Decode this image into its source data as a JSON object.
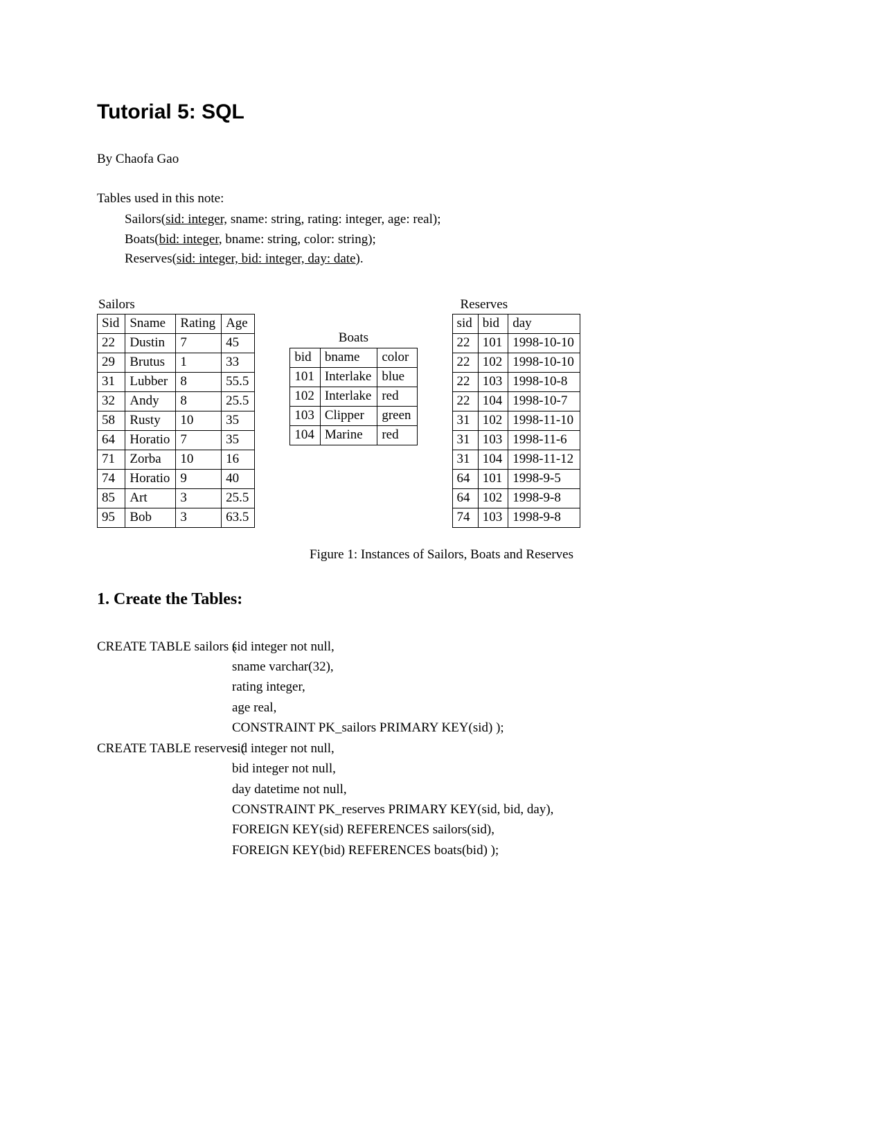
{
  "title": "Tutorial 5: SQL",
  "author": "By Chaofa Gao",
  "intro": "Tables used in this note:",
  "schemas": {
    "sailors_pre": "Sailors(",
    "sailors_key": "sid: integer,",
    "sailors_post": " sname: string, rating: integer, age: real);",
    "boats_pre": "Boats(",
    "boats_key": "bid: integer,",
    "boats_post": " bname: string, color: string);",
    "reserves_pre": "Reserves(",
    "reserves_key": "sid: integer, bid: integer, day: date",
    "reserves_post": ")."
  },
  "sailors_title": "Sailors",
  "sailors": {
    "headers": [
      "Sid",
      "Sname",
      "Rating",
      "Age"
    ],
    "rows": [
      [
        "22",
        "Dustin",
        "7",
        "45"
      ],
      [
        "29",
        "Brutus",
        "1",
        "33"
      ],
      [
        "31",
        "Lubber",
        "8",
        "55.5"
      ],
      [
        "32",
        "Andy",
        "8",
        "25.5"
      ],
      [
        "58",
        "Rusty",
        "10",
        "35"
      ],
      [
        "64",
        "Horatio",
        "7",
        "35"
      ],
      [
        "71",
        "Zorba",
        "10",
        "16"
      ],
      [
        "74",
        "Horatio",
        "9",
        "40"
      ],
      [
        "85",
        "Art",
        "3",
        "25.5"
      ],
      [
        "95",
        "Bob",
        "3",
        "63.5"
      ]
    ]
  },
  "boats_title": "Boats",
  "boats": {
    "headers": [
      "bid",
      "bname",
      "color"
    ],
    "rows": [
      [
        "101",
        "Interlake",
        "blue"
      ],
      [
        "102",
        "Interlake",
        "red"
      ],
      [
        "103",
        "Clipper",
        "green"
      ],
      [
        "104",
        "Marine",
        "red"
      ]
    ]
  },
  "reserves_title": "Reserves",
  "reserves": {
    "headers": [
      "sid",
      "bid",
      "day"
    ],
    "rows": [
      [
        "22",
        "101",
        "1998-10-10"
      ],
      [
        "22",
        "102",
        "1998-10-10"
      ],
      [
        "22",
        "103",
        "1998-10-8"
      ],
      [
        "22",
        "104",
        "1998-10-7"
      ],
      [
        "31",
        "102",
        "1998-11-10"
      ],
      [
        "31",
        "103",
        "1998-11-6"
      ],
      [
        "31",
        "104",
        "1998-11-12"
      ],
      [
        "64",
        "101",
        "1998-9-5"
      ],
      [
        "64",
        "102",
        "1998-9-8"
      ],
      [
        "74",
        "103",
        "1998-9-8"
      ]
    ]
  },
  "figure_caption": "Figure 1: Instances of Sailors, Boats and Reserves",
  "section1_title": "1. Create the Tables:",
  "sql": {
    "left1": "CREATE TABLE sailors (",
    "right1": "sid integer not null,\nsname varchar(32),\nrating integer,\nage real,\nCONSTRAINT PK_sailors PRIMARY KEY(sid) );",
    "left2": "CREATE TABLE reserves (",
    "right2": "sid integer not null,\nbid integer not null,\nday datetime not null,\nCONSTRAINT PK_reserves PRIMARY KEY(sid, bid, day),\nFOREIGN KEY(sid) REFERENCES sailors(sid),\nFOREIGN KEY(bid) REFERENCES boats(bid) );"
  }
}
